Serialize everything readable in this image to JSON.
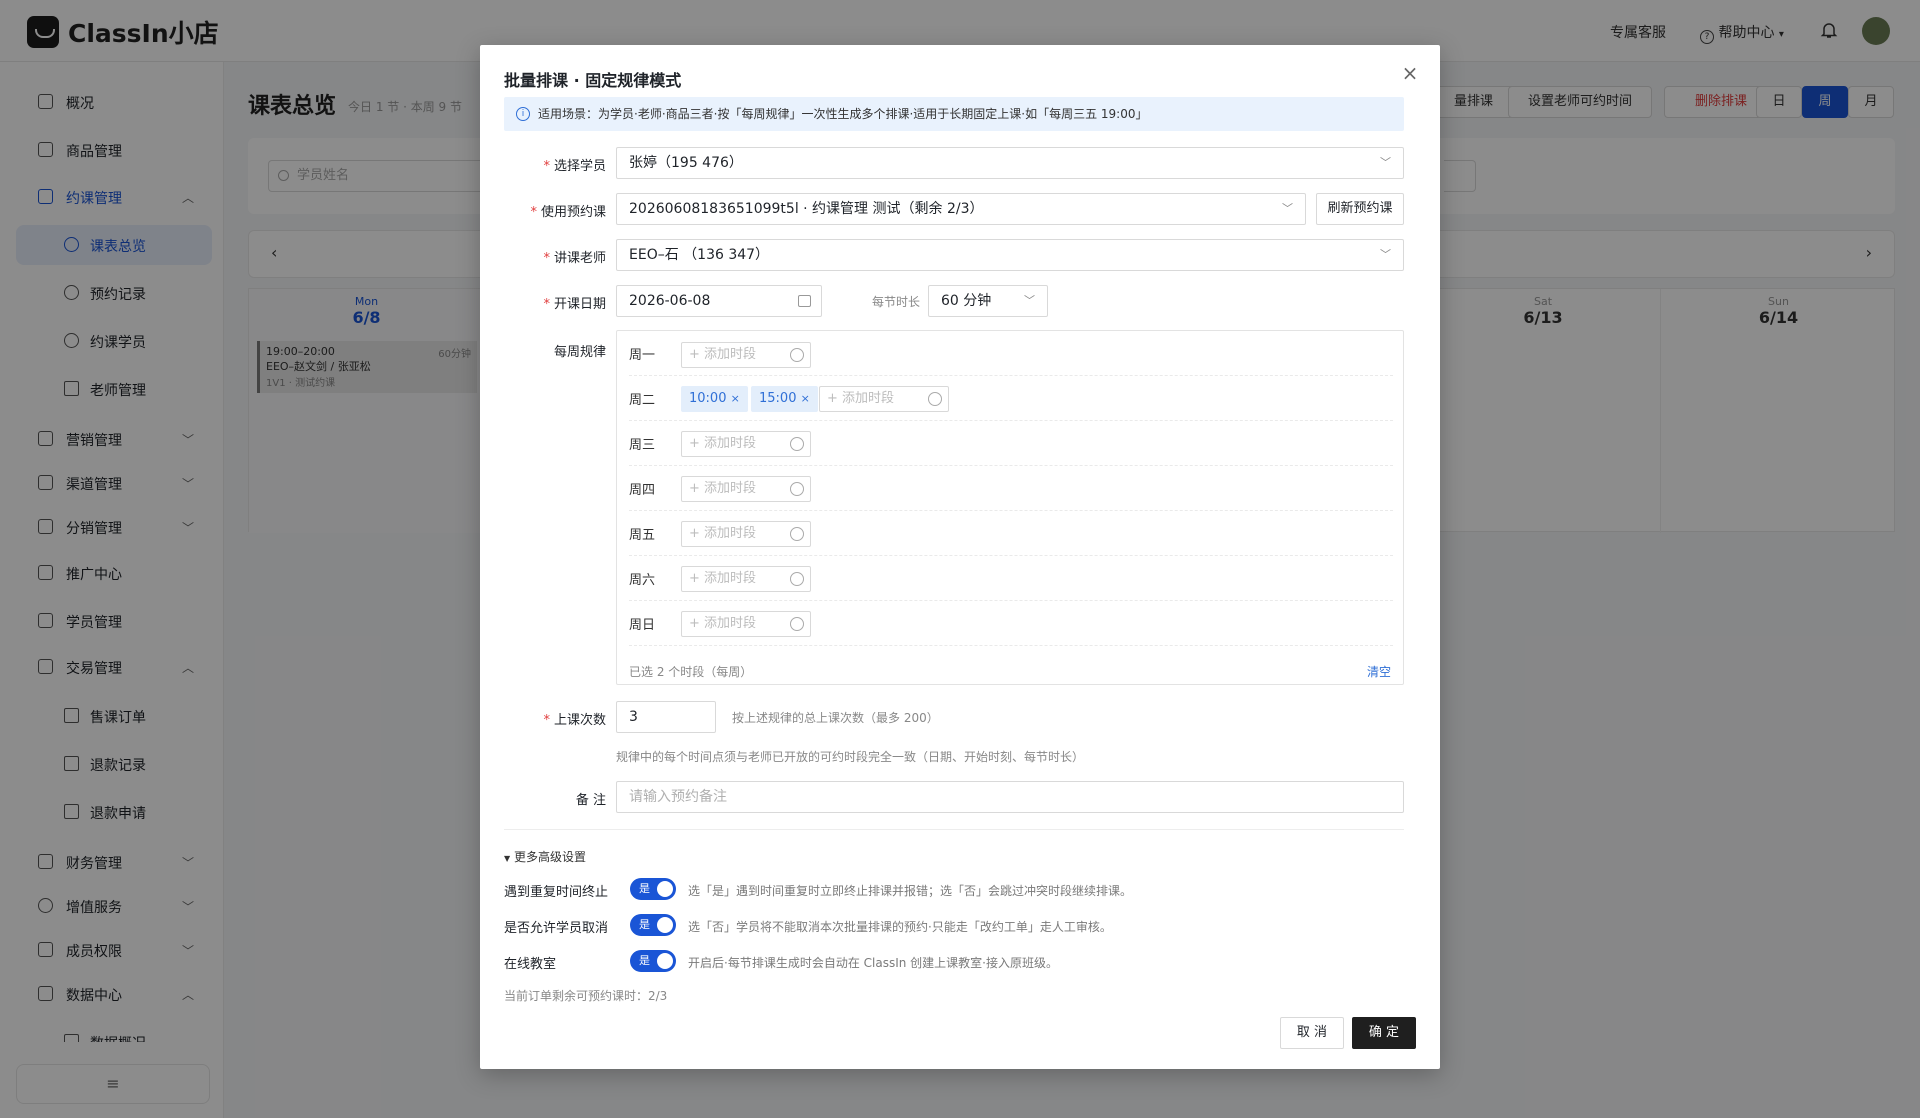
{
  "app": {
    "title": "ClassIn小店"
  },
  "header": {
    "service": "专属客服",
    "help": "帮助中心"
  },
  "sidebar": {
    "items": [
      {
        "label": "概况"
      },
      {
        "label": "商品管理"
      },
      {
        "label": "约课管理"
      },
      {
        "label": "课表总览"
      },
      {
        "label": "预约记录"
      },
      {
        "label": "约课学员"
      },
      {
        "label": "老师管理"
      },
      {
        "label": "营销管理"
      },
      {
        "label": "渠道管理"
      },
      {
        "label": "分销管理"
      },
      {
        "label": "推广中心"
      },
      {
        "label": "学员管理"
      },
      {
        "label": "交易管理"
      },
      {
        "label": "售课订单"
      },
      {
        "label": "退款记录"
      },
      {
        "label": "退款申请"
      },
      {
        "label": "财务管理"
      },
      {
        "label": "增值服务"
      },
      {
        "label": "成员权限"
      },
      {
        "label": "数据中心"
      },
      {
        "label": "数据概况"
      }
    ]
  },
  "main": {
    "title": "课表总览",
    "subtitle": "今日 1 节 · 本周 9 节",
    "search_placeholder": "学员姓名",
    "buttons": {
      "batch": "量排课",
      "teacher_time": "设置老师可约时间",
      "delete": "删除排课",
      "day": "日",
      "week": "周",
      "month": "月"
    },
    "days": [
      {
        "name": "Mon",
        "date": "6/8"
      },
      {
        "name": "Sat",
        "date": "6/13"
      },
      {
        "name": "Sun",
        "date": "6/14"
      }
    ],
    "event": {
      "time": "19:00–20:00",
      "duration": "60分钟",
      "people": "EEO–赵文剑 / 张亚松",
      "type": "1V1 · 测试约课"
    }
  },
  "modal": {
    "title": "批量排课 · 固定规律模式",
    "info": "适用场景：为学员·老师·商品三者·按「每周规律」一次性生成多个排课·适用于长期固定上课·如「每周三五 19:00」",
    "student_label": "选择学员",
    "student_value": "张婷（195         476）",
    "course_label": "使用预约课",
    "course_value": "20260608183651099t5l · 约课管理          测试（剩余 2/3）",
    "refresh_label": "刷新预约课",
    "teacher_label": "讲课老师",
    "teacher_value": "EEO–石      （136           347）",
    "date_label": "开课日期",
    "date_value": "2026-06-08",
    "duration_label": "每节时长",
    "duration_value": "60 分钟",
    "weekly_label": "每周规律",
    "weekdays": [
      "周一",
      "周二",
      "周三",
      "周四",
      "周五",
      "周六",
      "周日"
    ],
    "add_slot": "+ 添加时段",
    "tags": [
      "10:00",
      "15:00"
    ],
    "selected_summary": "已选 2 个时段（每周）",
    "clear": "清空",
    "count_label": "上课次数",
    "count_value": "3",
    "count_hint": "按上述规律的总上课次数（最多 200）",
    "rule_note": "规律中的每个时间点须与老师已开放的可约时段完全一致（日期、开始时刻、每节时长）",
    "note_label": "备 注",
    "note_placeholder": "请输入预约备注",
    "advanced": "更多高级设置",
    "toggles": [
      {
        "label": "遇到重复时间终止",
        "state": "是",
        "desc": "选「是」遇到时间重复时立即终止排课并报错；选「否」会跳过冲突时段继续排课。"
      },
      {
        "label": "是否允许学员取消",
        "state": "是",
        "desc": "选「否」学员将不能取消本次批量排课的预约·只能走「改约工单」走人工审核。"
      },
      {
        "label": "在线教室",
        "state": "是",
        "desc": "开启后·每节排课生成时会自动在 ClassIn 创建上课教室·接入原班级。"
      }
    ],
    "remaining": "当前订单剩余可预约课时：2/3",
    "cancel": "取 消",
    "confirm": "确 定"
  },
  "colors": {
    "accent": "#1a55d6",
    "danger": "#e03c3c",
    "dark_button": "#1f1f1f"
  }
}
